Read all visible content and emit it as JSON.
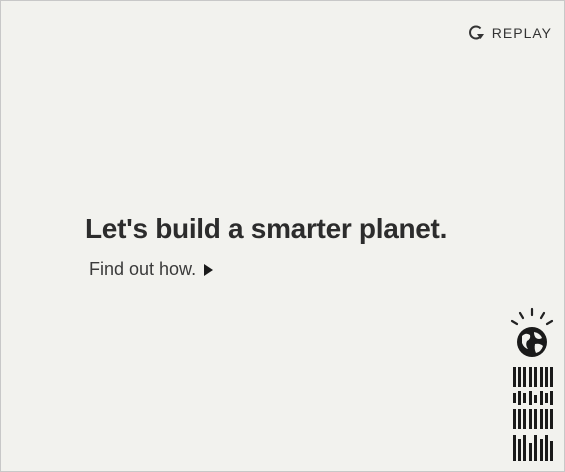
{
  "replay": {
    "label": "REPLAY",
    "icon": "replay-arrow-icon"
  },
  "headline": "Let's build a smarter planet.",
  "cta": {
    "label": "Find out how.",
    "icon": "play-triangle-icon"
  },
  "brand": {
    "logo_name": "IBM",
    "globe_icon": "smarter-planet-globe-icon"
  },
  "colors": {
    "background": "#f2f2ee",
    "text": "#2c2c2c",
    "border": "#c8c8c8"
  }
}
